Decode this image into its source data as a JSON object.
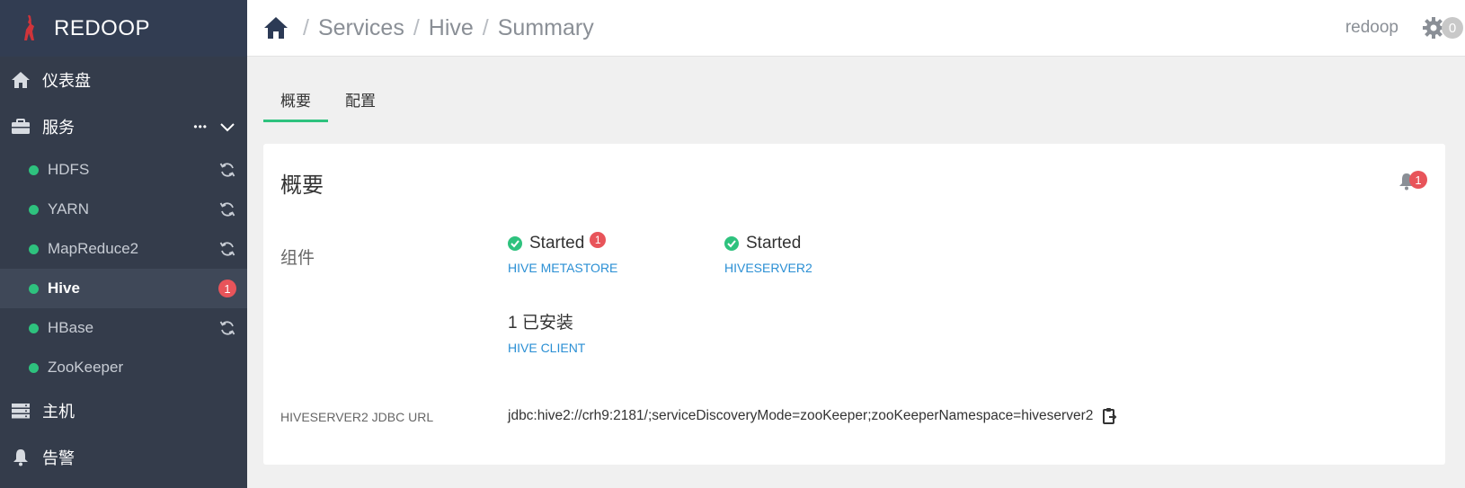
{
  "brand": {
    "name": "REDOOP"
  },
  "sidebar": {
    "dashboard": "仪表盘",
    "services": "服务",
    "services_more": "•••",
    "items": [
      {
        "label": "HDFS",
        "status_color": "#2ec27e",
        "action": "refresh"
      },
      {
        "label": "YARN",
        "status_color": "#2ec27e",
        "action": "refresh"
      },
      {
        "label": "MapReduce2",
        "status_color": "#2ec27e",
        "action": "refresh"
      },
      {
        "label": "Hive",
        "status_color": "#2ec27e",
        "badge": "1"
      },
      {
        "label": "HBase",
        "status_color": "#2ec27e",
        "action": "refresh"
      },
      {
        "label": "ZooKeeper",
        "status_color": "#2ec27e"
      }
    ],
    "hosts": "主机",
    "alerts": "告警"
  },
  "topbar": {
    "crumbs": [
      "Services",
      "Hive",
      "Summary"
    ],
    "separator": "/",
    "user": "redoop",
    "ops_count": "0"
  },
  "tabs": [
    {
      "label": "概要",
      "active": true
    },
    {
      "label": "配置",
      "active": false
    }
  ],
  "card": {
    "title": "概要",
    "alert_count": "1",
    "components_label": "组件",
    "components": [
      {
        "status": "Started",
        "name": "HIVE METASTORE",
        "badge": "1"
      },
      {
        "status": "Started",
        "name": "HIVESERVER2"
      }
    ],
    "clients": {
      "installed": "1 已安装",
      "name": "HIVE CLIENT"
    },
    "jdbc_label": "HIVESERVER2 JDBC URL",
    "jdbc_url": "jdbc:hive2://crh9:2181/;serviceDiscoveryMode=zooKeeper;zooKeeperNamespace=hiveserver2"
  },
  "colors": {
    "accent_green": "#2ec27e",
    "badge_red": "#e8545a",
    "link_blue": "#2a8fd4",
    "sidebar_bg": "#343c4b"
  }
}
